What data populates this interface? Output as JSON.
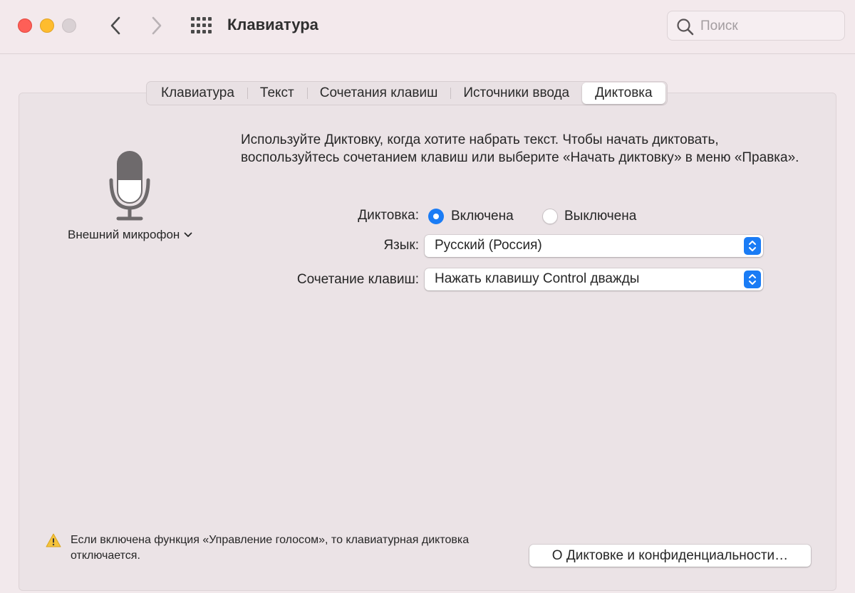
{
  "window": {
    "title": "Клавиатура"
  },
  "search": {
    "placeholder": "Поиск"
  },
  "tabs": [
    {
      "label": "Клавиатура"
    },
    {
      "label": "Текст"
    },
    {
      "label": "Сочетания клавиш"
    },
    {
      "label": "Источники ввода"
    },
    {
      "label": "Диктовка",
      "active": true
    }
  ],
  "mic": {
    "source": "Внешний микрофон"
  },
  "description": "Используйте Диктовку, когда хотите набрать текст. Чтобы начать диктовать, воспользуйтесь сочетанием клавиш или выберите «Начать диктовку» в меню «Правка».",
  "dictation": {
    "label": "Диктовка:",
    "on_label": "Включена",
    "off_label": "Выключена",
    "selected": "on"
  },
  "language": {
    "label": "Язык:",
    "value": "Русский (Россия)"
  },
  "shortcut": {
    "label": "Сочетание клавиш:",
    "value": "Нажать клавишу Control дважды"
  },
  "warning": {
    "text": "Если включена функция «Управление голосом», то клавиатурная диктовка отключается."
  },
  "about_button": {
    "label": "О Диктовке и конфиденциальности…"
  },
  "colors": {
    "accent": "#1a7cf5",
    "close": "#fe5f57",
    "minimize": "#febc2e"
  }
}
